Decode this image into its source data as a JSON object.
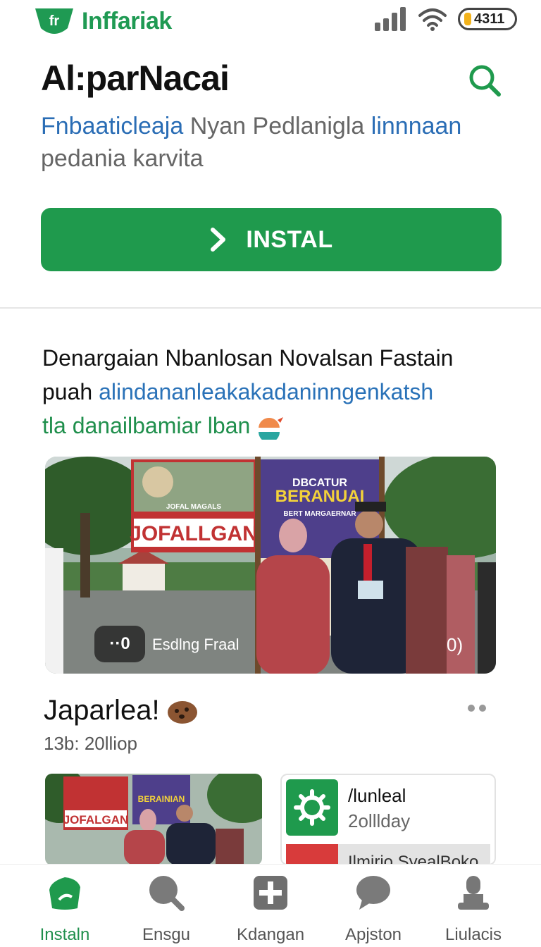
{
  "status_bar": {
    "app_name": "Inffariak",
    "logo_text": "fr",
    "battery": "4311",
    "icons": [
      "signal-icon",
      "wifi-icon",
      "battery-icon"
    ]
  },
  "header": {
    "title": "Al:parNacai",
    "subtitle_highlight": "Fnbaaticleaja",
    "subtitle_mid": " Nyan Pedlanigla ",
    "subtitle_highlight2": "linnnaan",
    "subtitle_line2": "pedania karvita",
    "install_label": "INSTAL"
  },
  "section": {
    "line1": "Denargaian Nbanlosan Novalsan Fastain",
    "line2_prefix": "puah ",
    "line2_link": "alindananleakakadaninngenkatsh",
    "line3": "tla danailbamiar lban"
  },
  "hero": {
    "chip": "··0",
    "caption": "Esdlng Fraal",
    "next": "0)",
    "banner_left": "JOFALLGAN",
    "banner_left_small": "JOFAL MAGALS",
    "banner_right_top": "DBCATUR",
    "banner_right_main": "BERANUAI",
    "banner_right_small": "BERT MARGAERNAR"
  },
  "post": {
    "title": "Japarlea!",
    "meta": "13b: 20lliop"
  },
  "thumb": {
    "banner_left": "JOFALGAN",
    "banner_right": "BERAINIAN"
  },
  "app_card": {
    "name": "/lunleal",
    "sub": "2olllday",
    "row2": "Ilmirio SyealBoko"
  },
  "bottom_nav": {
    "items": [
      {
        "label": "Instaln",
        "icon": "home-icon"
      },
      {
        "label": "Ensgu",
        "icon": "search-icon"
      },
      {
        "label": "Kdangan",
        "icon": "plus-icon"
      },
      {
        "label": "Apjston",
        "icon": "chat-icon"
      },
      {
        "label": "Liulacis",
        "icon": "profile-icon"
      }
    ]
  },
  "colors": {
    "brand_green": "#1f9a4d",
    "link_blue": "#2a72b8",
    "text": "#111111"
  }
}
